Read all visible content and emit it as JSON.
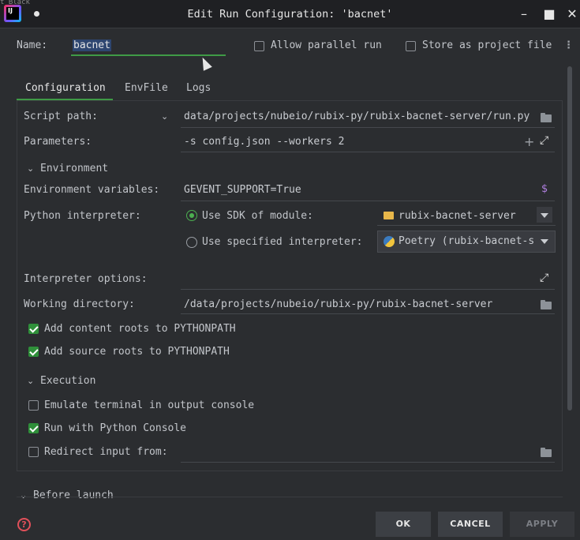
{
  "window": {
    "title": "Edit Run Configuration: 'bacnet'",
    "background_text": "t Black",
    "app_icon_letters": "IJ"
  },
  "header": {
    "name_label": "Name:",
    "name_value": "bacnet",
    "allow_parallel_label": "Allow parallel run",
    "allow_parallel_checked": false,
    "store_project_label": "Store as project file",
    "store_project_checked": false
  },
  "tabs": [
    {
      "label": "Configuration",
      "active": true
    },
    {
      "label": "EnvFile",
      "active": false
    },
    {
      "label": "Logs",
      "active": false
    }
  ],
  "config": {
    "script_path_label": "Script path:",
    "script_path_value": "data/projects/nubeio/rubix-py/rubix-bacnet-server/run.py",
    "parameters_label": "Parameters:",
    "parameters_value": "-s config.json --workers 2",
    "environment_section": "Environment",
    "env_vars_label": "Environment variables:",
    "env_vars_value": "GEVENT_SUPPORT=True",
    "interpreter_label": "Python interpreter:",
    "use_sdk_label": "Use SDK of module:",
    "use_sdk_selected": true,
    "sdk_module_value": "rubix-bacnet-server",
    "use_specified_label": "Use specified interpreter:",
    "use_specified_selected": false,
    "specified_value": "Poetry (rubix-bacnet-s",
    "interp_options_label": "Interpreter options:",
    "interp_options_value": "",
    "working_dir_label": "Working directory:",
    "working_dir_value": "/data/projects/nubeio/rubix-py/rubix-bacnet-server",
    "add_content_roots_label": "Add content roots to PYTHONPATH",
    "add_content_roots_checked": true,
    "add_source_roots_label": "Add source roots to PYTHONPATH",
    "add_source_roots_checked": true,
    "execution_section": "Execution",
    "emulate_terminal_label": "Emulate terminal in output console",
    "emulate_terminal_checked": false,
    "run_console_label": "Run with Python Console",
    "run_console_checked": true,
    "redirect_input_label": "Redirect input from:",
    "redirect_input_checked": false,
    "redirect_input_value": ""
  },
  "before_launch_section": "Before launch",
  "footer": {
    "ok_label": "OK",
    "cancel_label": "CANCEL",
    "apply_label": "APPLY",
    "help_glyph": "?"
  },
  "colors": {
    "accent_green": "#3f9a46",
    "background": "#2b2d30",
    "help_red": "#e0505a"
  }
}
